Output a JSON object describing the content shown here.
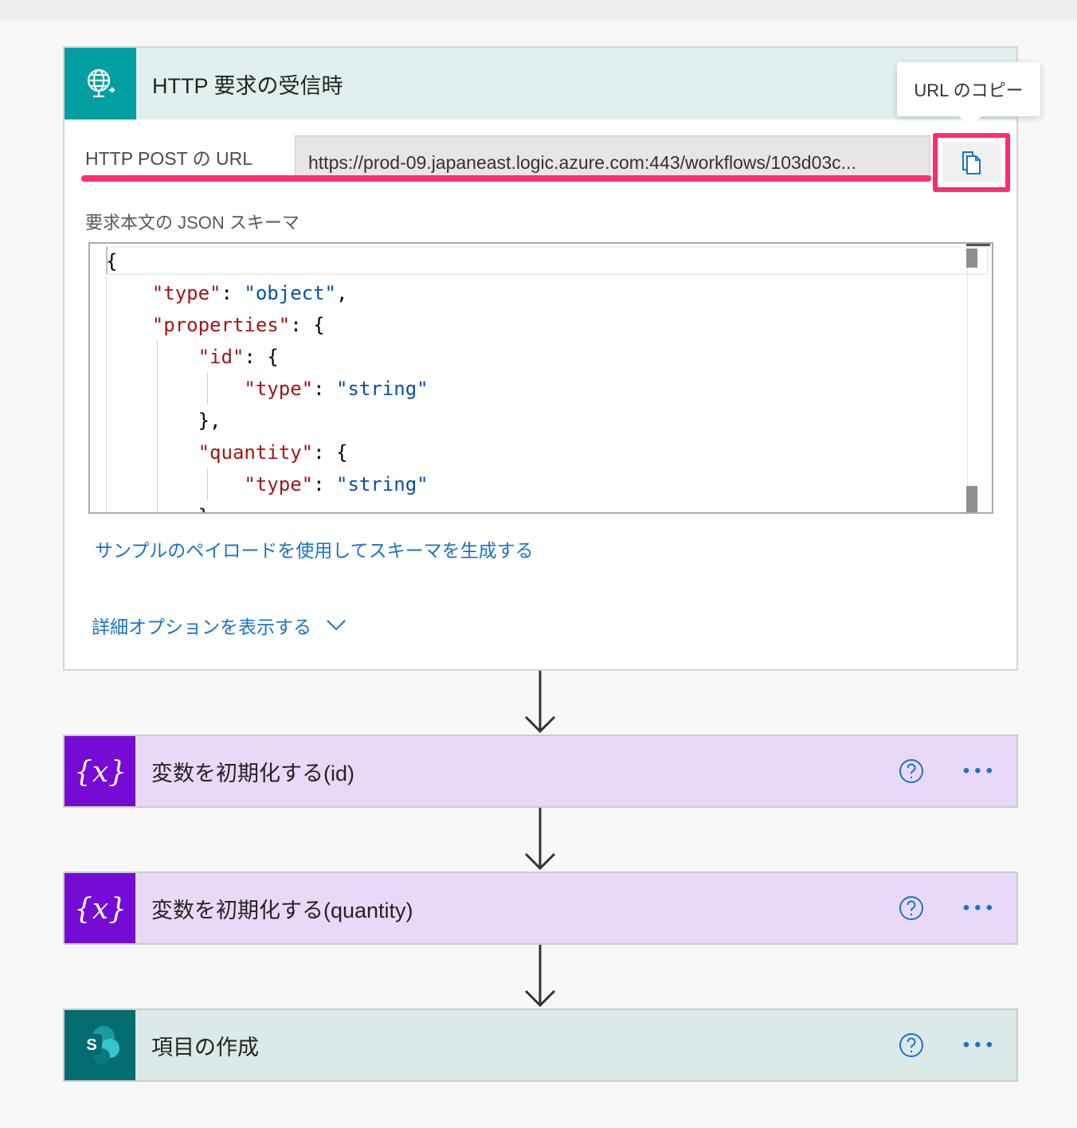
{
  "trigger": {
    "title": "HTTP 要求の受信時",
    "icon": "globe-request-icon",
    "url_label": "HTTP POST の URL",
    "url_value": "https://prod-09.japaneast.logic.azure.com:443/workflows/103d03c...",
    "copy_tooltip": "URL のコピー",
    "schema_label": "要求本文の JSON スキーマ",
    "code_lines": [
      "{",
      "    \"type\": \"object\",",
      "    \"properties\": {",
      "        \"id\": {",
      "            \"type\": \"string\"",
      "        },",
      "        \"quantity\": {",
      "            \"type\": \"string\"",
      "        }"
    ],
    "sample_link": "サンプルのペイロードを使用してスキーマを生成する",
    "advanced_link": "詳細オプションを表示する"
  },
  "actions": [
    {
      "title": "変数を初期化する(id)",
      "icon": "variable-icon"
    },
    {
      "title": "変数を初期化する(quantity)",
      "icon": "variable-icon"
    },
    {
      "title": "項目の作成",
      "icon": "sharepoint-icon"
    }
  ],
  "colors": {
    "highlight": "#ff2d6f",
    "link": "#1a73c7",
    "trigger_icon_bg": "#00a0a2",
    "variable_icon_bg": "#770bd6",
    "sharepoint_icon_bg": "#036c70"
  }
}
